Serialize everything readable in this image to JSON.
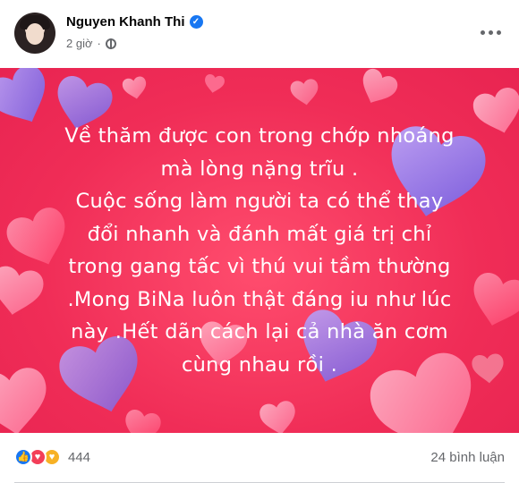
{
  "post": {
    "author": "Nguyen Khanh Thi",
    "time": "2 giờ",
    "background_colors": {
      "base": "#f02d57",
      "heart_pink": "#ff8fb0",
      "heart_purple": "#8f7cf0"
    },
    "text_lines": [
      "Về thăm được con trong chớp nhoáng",
      "mà lòng nặng trĩu .",
      "Cuộc sống làm người ta có thể thay",
      "đổi nhanh và đánh mất giá trị chỉ",
      "trong gang tấc vì thú vui tầm thường",
      ".Mong BiNa luôn thật đáng iu như lúc",
      "này .Hết dãn cách lại cả nhà ăn cơm",
      "cùng nhau rồi ."
    ]
  },
  "footer": {
    "reaction_icons": [
      "like-icon",
      "love-icon",
      "care-icon"
    ],
    "reaction_count": "444",
    "comments": "24 bình luận"
  }
}
